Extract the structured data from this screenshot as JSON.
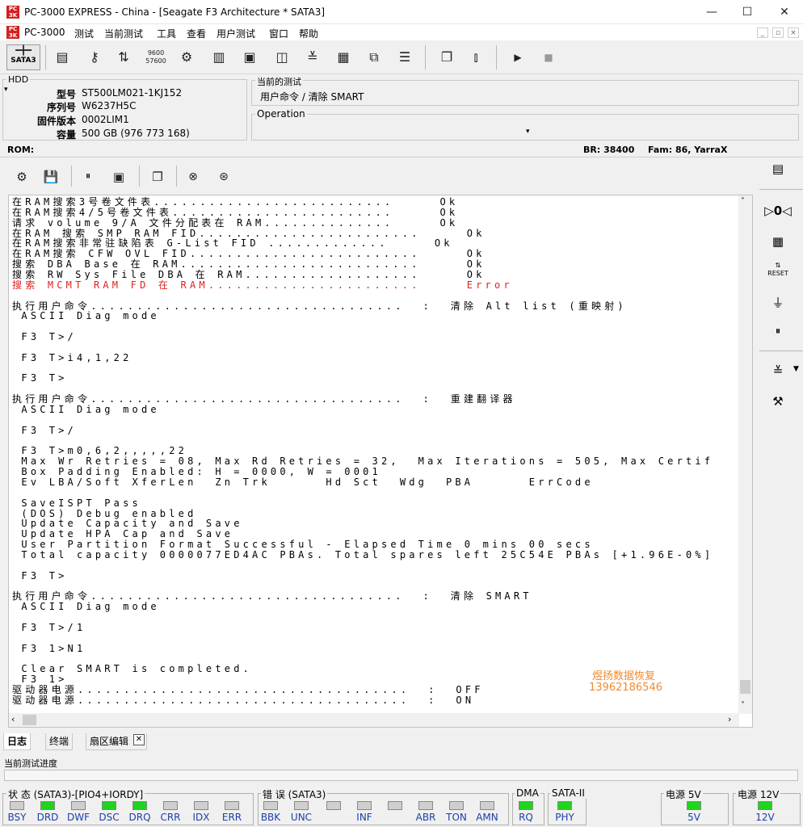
{
  "window": {
    "title": "PC-3000 EXPRESS - China - [Seagate F3 Architecture * SATA3]",
    "minimize": "—",
    "maximize": "☐",
    "close": "✕"
  },
  "menu": [
    "PC-3000",
    "测试",
    "当前测试",
    "工具",
    "查看",
    "用户测试",
    "窗口",
    "帮助"
  ],
  "toolbar": {
    "sata_label": "SATA3"
  },
  "hdd": {
    "legend": "HDD",
    "fields": [
      {
        "label": "型号",
        "value": "ST500LM021-1KJ152"
      },
      {
        "label": "序列号",
        "value": "W6237H5C"
      },
      {
        "label": "固件版本",
        "value": "0002LIM1"
      },
      {
        "label": "容量",
        "value": "500 GB (976 773 168)"
      }
    ]
  },
  "current_test": {
    "legend": "当前的测试",
    "value": "用户命令 / 清除 SMART"
  },
  "operation": {
    "legend": "Operation",
    "value": ""
  },
  "rom_bar": {
    "rom": "ROM:",
    "br": "BR: 38400",
    "fam": "Fam: 86, YarraX"
  },
  "log": [
    {
      "text": "在RAM搜索3号卷文件表..........................     Ok",
      "err": false
    },
    {
      "text": "在RAM搜索4/5号卷文件表........................     Ok",
      "err": false
    },
    {
      "text": "请求 volume 9/A 文件分配表在 RAM..............     Ok",
      "err": false
    },
    {
      "text": "在RAM 搜索 SMP RAM FID........................     Ok",
      "err": false
    },
    {
      "text": "在RAM搜索非常驻缺陷表 G-List FID .............     Ok",
      "err": false
    },
    {
      "text": "在RAM搜索 CFW OVL FID.........................     Ok",
      "err": false
    },
    {
      "text": "搜索 DBA Base 在 RAM..........................     Ok",
      "err": false
    },
    {
      "text": "搜索 RW Sys File DBA 在 RAM...................     Ok",
      "err": false
    },
    {
      "text": "搜索 MCMT RAM FD 在 RAM.......................     Error",
      "err": true
    },
    {
      "text": "",
      "err": false
    },
    {
      "text": "执行用户命令..................................  :  清除 Alt list (重映射)",
      "err": false
    },
    {
      "text": " ASCII Diag mode",
      "err": false
    },
    {
      "text": "",
      "err": false
    },
    {
      "text": " F3 T>/",
      "err": false
    },
    {
      "text": "",
      "err": false
    },
    {
      "text": " F3 T>i4,1,22",
      "err": false
    },
    {
      "text": "",
      "err": false
    },
    {
      "text": " F3 T>",
      "err": false
    },
    {
      "text": "",
      "err": false
    },
    {
      "text": "执行用户命令..................................  :  重建翻译器",
      "err": false
    },
    {
      "text": " ASCII Diag mode",
      "err": false
    },
    {
      "text": "",
      "err": false
    },
    {
      "text": " F3 T>/",
      "err": false
    },
    {
      "text": "",
      "err": false
    },
    {
      "text": " F3 T>m0,6,2,,,,,22",
      "err": false
    },
    {
      "text": " Max Wr Retries = 08, Max Rd Retries = 32,  Max Iterations = 505, Max Certif",
      "err": false
    },
    {
      "text": " Box Padding Enabled: H = 0000, W = 0001",
      "err": false
    },
    {
      "text": " Ev LBA/Soft XferLen  Zn Trk      Hd Sct  Wdg  PBA      ErrCode",
      "err": false
    },
    {
      "text": "",
      "err": false
    },
    {
      "text": " SaveISPT Pass",
      "err": false
    },
    {
      "text": " (DOS) Debug enabled",
      "err": false
    },
    {
      "text": " Update Capacity and Save",
      "err": false
    },
    {
      "text": " Update HPA Cap and Save",
      "err": false
    },
    {
      "text": " User Partition Format Successful - Elapsed Time 0 mins 00 secs",
      "err": false
    },
    {
      "text": " Total capacity 0000077ED4AC PBAs. Total spares left 25C54E PBAs [+1.96E-0%]",
      "err": false
    },
    {
      "text": "",
      "err": false
    },
    {
      "text": " F3 T>",
      "err": false
    },
    {
      "text": "",
      "err": false
    },
    {
      "text": "执行用户命令..................................  :  清除 SMART",
      "err": false
    },
    {
      "text": " ASCII Diag mode",
      "err": false
    },
    {
      "text": "",
      "err": false
    },
    {
      "text": " F3 T>/1",
      "err": false
    },
    {
      "text": "",
      "err": false
    },
    {
      "text": " F3 1>N1",
      "err": false
    },
    {
      "text": "",
      "err": false
    },
    {
      "text": " Clear SMART is completed.",
      "err": false
    },
    {
      "text": " F3 1>",
      "err": false
    },
    {
      "text": "驱动器电源....................................  :  OFF",
      "err": false
    },
    {
      "text": "驱动器电源....................................  :  ON",
      "err": false
    }
  ],
  "watermark": {
    "line1": "煜扬数据恢复",
    "line2": "13962186546"
  },
  "tabs": [
    "日志",
    "终端",
    "扇区编辑"
  ],
  "progress_label": "当前测试进度",
  "status": {
    "group_state": "状 态 (SATA3)-[PIO4+IORDY]",
    "group_error": "错 误 (SATA3)",
    "group_dma": "DMA",
    "group_sata": "SATA-II",
    "group_5v": "电源 5V",
    "group_12v": "电源 12V",
    "leds": [
      {
        "label": "BSY",
        "on": false
      },
      {
        "label": "DRD",
        "on": true
      },
      {
        "label": "DWF",
        "on": false
      },
      {
        "label": "DSC",
        "on": true
      },
      {
        "label": "DRQ",
        "on": true
      },
      {
        "label": "CRR",
        "on": false
      },
      {
        "label": "IDX",
        "on": false
      },
      {
        "label": "ERR",
        "on": false
      },
      {
        "label": "BBK",
        "on": false
      },
      {
        "label": "UNC",
        "on": false
      },
      {
        "label": "",
        "on": false
      },
      {
        "label": "INF",
        "on": false
      },
      {
        "label": "",
        "on": false
      },
      {
        "label": "ABR",
        "on": false
      },
      {
        "label": "TON",
        "on": false
      },
      {
        "label": "AMN",
        "on": false
      },
      {
        "label": "RQ",
        "on": true
      },
      {
        "label": "PHY",
        "on": true
      },
      {
        "label": "5V",
        "on": true
      },
      {
        "label": "12V",
        "on": true
      }
    ]
  },
  "colors": {
    "error": "#e02020",
    "led_on": "#1fd41f",
    "led_off": "#cfcfcf",
    "label_blue": "#1a3fa8",
    "watermark": "#f08a30"
  }
}
